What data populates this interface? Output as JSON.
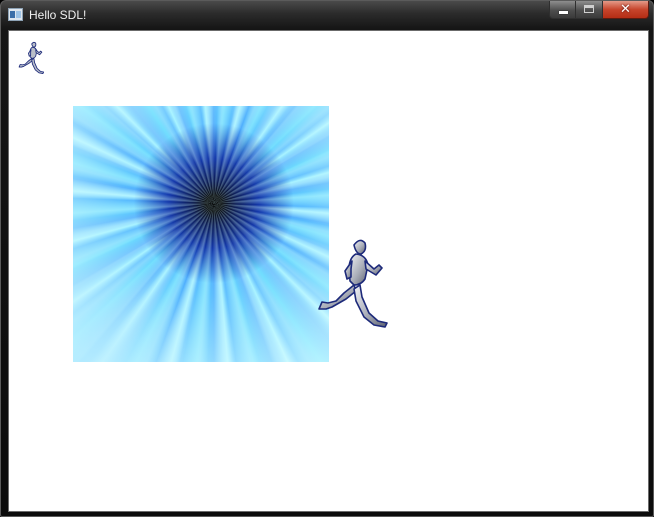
{
  "window": {
    "title": "Hello SDL!",
    "icon": "sdl-app-icon",
    "controls": {
      "minimize": "minimize-icon",
      "maximize": "maximize-icon",
      "close": "close-icon",
      "close_glyph": "✕"
    }
  },
  "canvas": {
    "background_color": "#ffffff",
    "sprites": [
      {
        "name": "running-man-small",
        "icon": "running-man-icon"
      },
      {
        "name": "swirl-texture",
        "icon": "blue-vortex-image"
      },
      {
        "name": "running-man-large",
        "icon": "running-man-icon"
      }
    ]
  },
  "colors": {
    "frame": "#1a1a1a",
    "close_button": "#c7452c",
    "vortex_blue": "#2a68e8"
  }
}
